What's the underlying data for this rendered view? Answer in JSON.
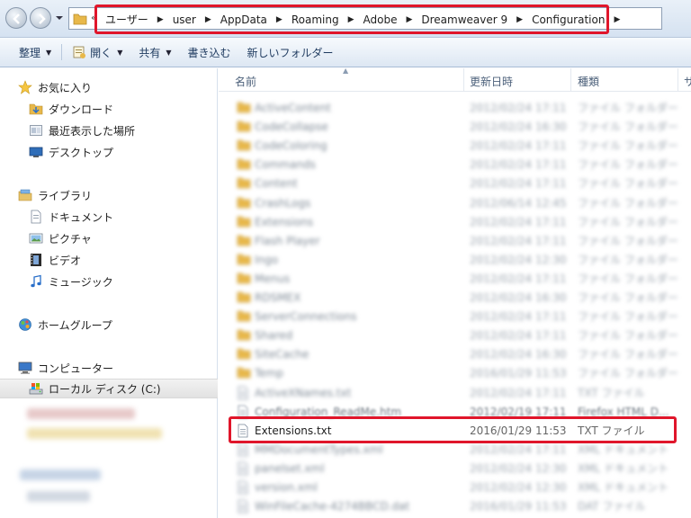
{
  "address_bar": {
    "overflow": "«",
    "crumbs": [
      "ユーザー",
      "user",
      "AppData",
      "Roaming",
      "Adobe",
      "Dreamweaver 9",
      "Configuration"
    ]
  },
  "toolbar": {
    "organize": "整理",
    "open": "開く",
    "share": "共有",
    "burn": "書き込む",
    "new_folder": "新しいフォルダー"
  },
  "sidebar": {
    "favorites": "お気に入り",
    "downloads": "ダウンロード",
    "recent": "最近表示した場所",
    "desktop": "デスクトップ",
    "libraries": "ライブラリ",
    "documents": "ドキュメント",
    "pictures": "ピクチャ",
    "videos": "ビデオ",
    "music": "ミュージック",
    "homegroup": "ホームグループ",
    "computer": "コンピューター",
    "local_disk": "ローカル ディスク (C:)"
  },
  "columns": {
    "name": "名前",
    "date": "更新日時",
    "type": "種類",
    "size": "サ"
  },
  "files": [
    {
      "name": "ActiveContent",
      "date": "2012/02/24 17:11",
      "type": "ファイル フォルダー",
      "kind": "folder",
      "clarity": "blur"
    },
    {
      "name": "CodeCollapse",
      "date": "2012/02/24 16:30",
      "type": "ファイル フォルダー",
      "kind": "folder",
      "clarity": "blur"
    },
    {
      "name": "CodeColoring",
      "date": "2012/02/24 17:11",
      "type": "ファイル フォルダー",
      "kind": "folder",
      "clarity": "blur"
    },
    {
      "name": "Commands",
      "date": "2012/02/24 17:11",
      "type": "ファイル フォルダー",
      "kind": "folder",
      "clarity": "blur"
    },
    {
      "name": "Content",
      "date": "2012/02/24 17:11",
      "type": "ファイル フォルダー",
      "kind": "folder",
      "clarity": "blur"
    },
    {
      "name": "CrashLogs",
      "date": "2012/06/14 12:45",
      "type": "ファイル フォルダー",
      "kind": "folder",
      "clarity": "blur"
    },
    {
      "name": "Extensions",
      "date": "2012/02/24 17:11",
      "type": "ファイル フォルダー",
      "kind": "folder",
      "clarity": "blur"
    },
    {
      "name": "Flash Player",
      "date": "2012/02/24 17:11",
      "type": "ファイル フォルダー",
      "kind": "folder",
      "clarity": "blur"
    },
    {
      "name": "Ingo",
      "date": "2012/02/24 12:30",
      "type": "ファイル フォルダー",
      "kind": "folder",
      "clarity": "blur"
    },
    {
      "name": "Menus",
      "date": "2012/02/24 17:11",
      "type": "ファイル フォルダー",
      "kind": "folder",
      "clarity": "blur"
    },
    {
      "name": "RDSMEX",
      "date": "2012/02/24 16:30",
      "type": "ファイル フォルダー",
      "kind": "folder",
      "clarity": "blur"
    },
    {
      "name": "ServerConnections",
      "date": "2012/02/24 17:11",
      "type": "ファイル フォルダー",
      "kind": "folder",
      "clarity": "blur"
    },
    {
      "name": "Shared",
      "date": "2012/02/24 17:11",
      "type": "ファイル フォルダー",
      "kind": "folder",
      "clarity": "blur"
    },
    {
      "name": "SiteCache",
      "date": "2012/02/24 16:30",
      "type": "ファイル フォルダー",
      "kind": "folder",
      "clarity": "blur"
    },
    {
      "name": "Temp",
      "date": "2016/01/29 11:53",
      "type": "ファイル フォルダー",
      "kind": "folder",
      "clarity": "blur"
    },
    {
      "name": "ActiveXNames.txt",
      "date": "2012/02/24 17:11",
      "type": "TXT ファイル",
      "kind": "file",
      "clarity": "blur"
    },
    {
      "name": "Configuration_ReadMe.htm",
      "date": "2012/02/19 17:11",
      "type": "Firefox HTML D...",
      "kind": "file",
      "clarity": "half"
    },
    {
      "name": "Extensions.txt",
      "date": "2016/01/29 11:53",
      "type": "TXT ファイル",
      "kind": "file",
      "clarity": "sharp"
    },
    {
      "name": "MMDocumentTypes.xml",
      "date": "2012/02/24 17:11",
      "type": "XML ドキュメント",
      "kind": "file",
      "clarity": "blur"
    },
    {
      "name": "panelset.xml",
      "date": "2012/02/24 12:30",
      "type": "XML ドキュメント",
      "kind": "file",
      "clarity": "blur"
    },
    {
      "name": "version.xml",
      "date": "2012/02/24 12:30",
      "type": "XML ドキュメント",
      "kind": "file",
      "clarity": "blur"
    },
    {
      "name": "WinFileCache-4274BBCD.dat",
      "date": "2016/01/29 11:53",
      "type": "DAT ファイル",
      "kind": "file",
      "clarity": "blur"
    }
  ],
  "colors": {
    "highlight": "#e0162b",
    "folder": "#e8b84a",
    "nav_text": "#1e3a5f"
  }
}
